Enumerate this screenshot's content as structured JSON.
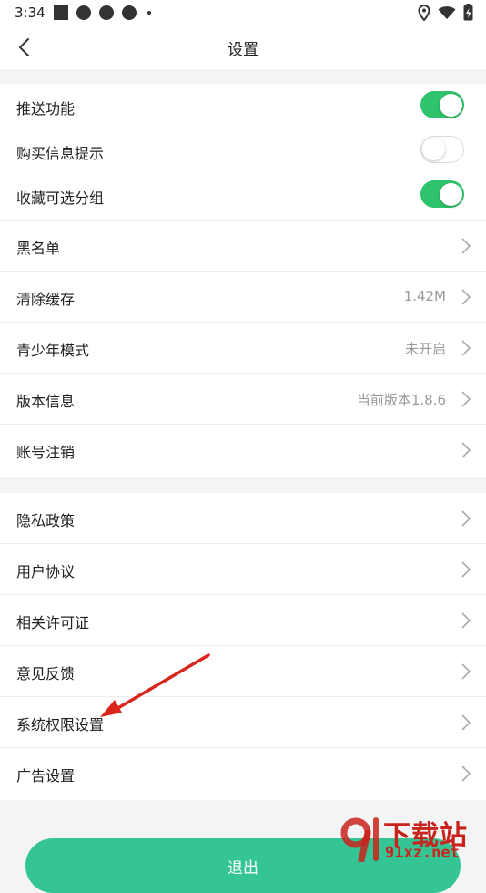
{
  "status_bar": {
    "time": "3:34"
  },
  "header": {
    "title": "设置"
  },
  "toggles": [
    {
      "label": "推送功能",
      "on": true
    },
    {
      "label": "购买信息提示",
      "on": false
    },
    {
      "label": "收藏可选分组",
      "on": true
    }
  ],
  "group1": [
    {
      "label": "黑名单",
      "value": ""
    },
    {
      "label": "清除缓存",
      "value": "1.42M"
    },
    {
      "label": "青少年模式",
      "value": "未开启"
    },
    {
      "label": "版本信息",
      "value": "当前版本1.8.6"
    },
    {
      "label": "账号注销",
      "value": ""
    }
  ],
  "group2": [
    {
      "label": "隐私政策"
    },
    {
      "label": "用户协议"
    },
    {
      "label": "相关许可证"
    },
    {
      "label": "意见反馈"
    },
    {
      "label": "系统权限设置"
    },
    {
      "label": "广告设置"
    }
  ],
  "logout_label": "退出",
  "watermark": {
    "text": "下载站",
    "url": "91xz.net"
  },
  "colors": {
    "toggle_on": "#2fc46c",
    "logout": "#35c594",
    "annotation_arrow": "#d9251c"
  }
}
